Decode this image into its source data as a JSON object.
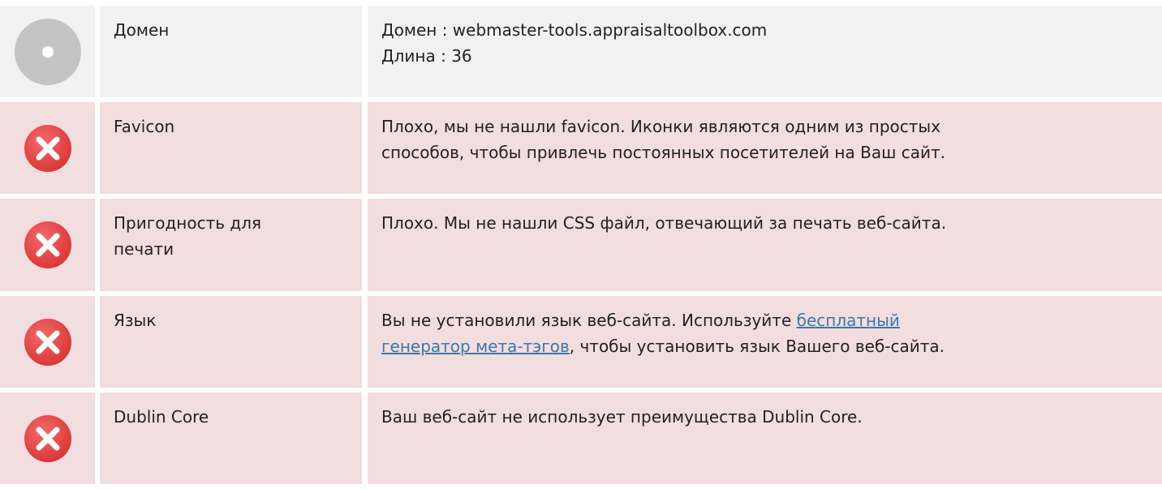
{
  "rows": {
    "domain": {
      "label": "Домен",
      "line1": "Домен : webmaster-tools.appraisaltoolbox.com",
      "line2": "Длина : 36"
    },
    "favicon": {
      "label": "Favicon",
      "line1": "Плохо, мы не нашли favicon. Иконки являются одним из простых",
      "line2": "способов, чтобы привлечь постоянных посетителей на Ваш сайт."
    },
    "printability": {
      "label_line1": "Пригодность для",
      "label_line2": "печати",
      "line1": "Плохо. Мы не нашли CSS файл, отвечающий за печать веб-сайта."
    },
    "language": {
      "label": "Язык",
      "text_before": "Вы не установили язык веб-сайта. Используйте ",
      "link_part1": "бесплатный",
      "link_part2": "генератор мета-тэгов",
      "text_after": ", чтобы установить язык Вашего веб-сайта."
    },
    "dublin_core": {
      "label": "Dublin Core",
      "line1": "Ваш веб-сайт не использует преимущества Dublin Core."
    }
  },
  "colors": {
    "neutral_bg": "#f2f2f2",
    "error_bg": "#f2dddf",
    "error_icon": "#e03c3c",
    "link": "#3b78a8"
  },
  "icons": {
    "neutral": "info-circle-icon",
    "error": "error-x-icon"
  }
}
